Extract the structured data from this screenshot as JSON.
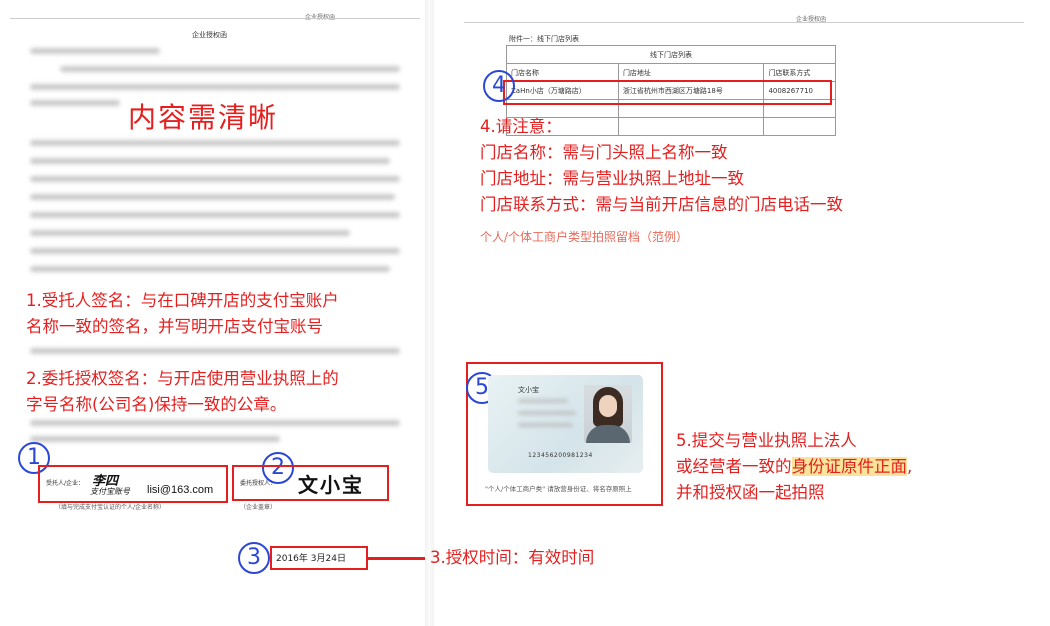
{
  "document": {
    "header_left": "企业授权函",
    "header_right": "企业授权函",
    "title": "企业授权函",
    "overlay_title": "内容需清晰",
    "annex_title": "附件一：线下门店列表",
    "table_title": "线下门店列表",
    "table_headers": [
      "门店名称",
      "门店地址",
      "门店联系方式"
    ],
    "table_row": [
      "ZaHn小店（万塘路店）",
      "浙江省杭州市西湖区万塘路18号",
      "4008267710"
    ]
  },
  "notes": {
    "n1_line1": "1.受托人签名：与在口碑开店的支付宝账户",
    "n1_line2": "名称一致的签名，并写明开店支付宝账号",
    "n2_line1": "2.委托授权签名：与开店使用营业执照上的",
    "n2_line2": "字号名称(公司名)保持一致的公章。",
    "n3": "3.授权时间：有效时间",
    "n4_title": "4.请注意：",
    "n4_line1": "门店名称：需与门头照上名称一致",
    "n4_line2": "门店地址：需与营业执照上地址一致",
    "n4_line3": "门店联系方式：需与当前开店信息的门店电话一致",
    "n4_sub": "个人/个体工商户类型拍照留档（范例）",
    "n5_line1": "5.提交与营业执照上法人",
    "n5_line2_pre": "或经营者一致的",
    "n5_line2_hl": "身份证原件正面",
    "n5_line2_post": ",",
    "n5_line3": "并和授权函一起拍照"
  },
  "markers": [
    "1",
    "2",
    "3",
    "4",
    "5"
  ],
  "signature": {
    "label_trustee": "受托人/企业：",
    "name": "李四",
    "account_label": "支付宝账号",
    "email": "lisi@163.com",
    "caption_trustee": "（填与完成支付宝认证的个人/企业名称）",
    "label_principal": "委托授权人：",
    "stamp_name": "文小宝",
    "caption_principal": "（企业盖章）",
    "date_year": "2016",
    "date_text": "年",
    "date_month": "3",
    "date_month_label": "月",
    "date_day": "24",
    "date_day_label": "日"
  },
  "idcard": {
    "name": "文小宝",
    "number": "123456200981234",
    "caption": "\"个人/个体工商户类\" 请放营身份证、将名存原照上"
  },
  "colors": {
    "accent_red": "#e3201f",
    "marker_blue": "#2b47d6",
    "highlight": "#fbe39a"
  }
}
